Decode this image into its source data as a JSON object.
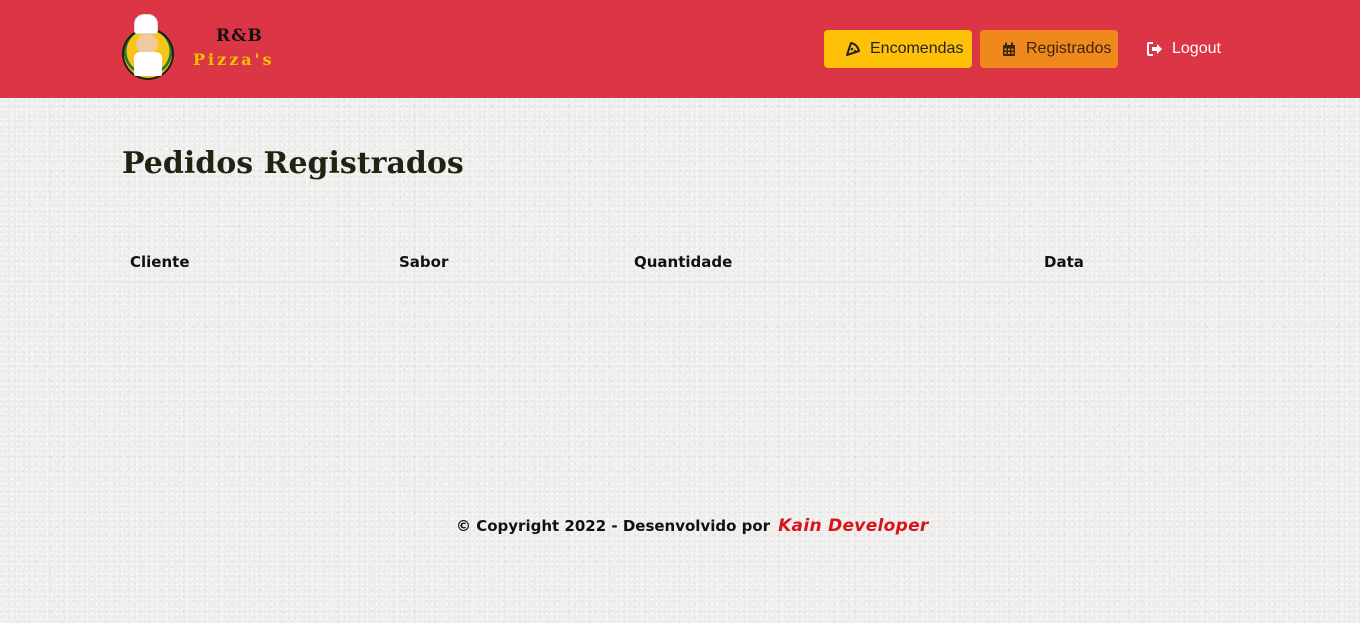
{
  "header": {
    "logo": {
      "line1": "R&B",
      "line2": "Pizza's"
    },
    "nav": {
      "encomendas": {
        "label": "Encomendas",
        "icon": "pizza-slice-icon",
        "color": "#ffc107"
      },
      "registrados": {
        "label": "Registrados",
        "icon": "calendar-icon",
        "color": "#f0891b"
      },
      "logout": {
        "label": "Logout",
        "icon": "sign-out-icon"
      }
    },
    "background_color": "#dc3545"
  },
  "main": {
    "title": "Pedidos Registrados",
    "table": {
      "columns": [
        "Cliente",
        "Sabor",
        "Quantidade",
        "Data"
      ],
      "rows": []
    }
  },
  "footer": {
    "copyright": "© Copyright 2022 - Desenvolvido por",
    "brand": "Kain Developer",
    "brand_color": "#d7141a"
  }
}
